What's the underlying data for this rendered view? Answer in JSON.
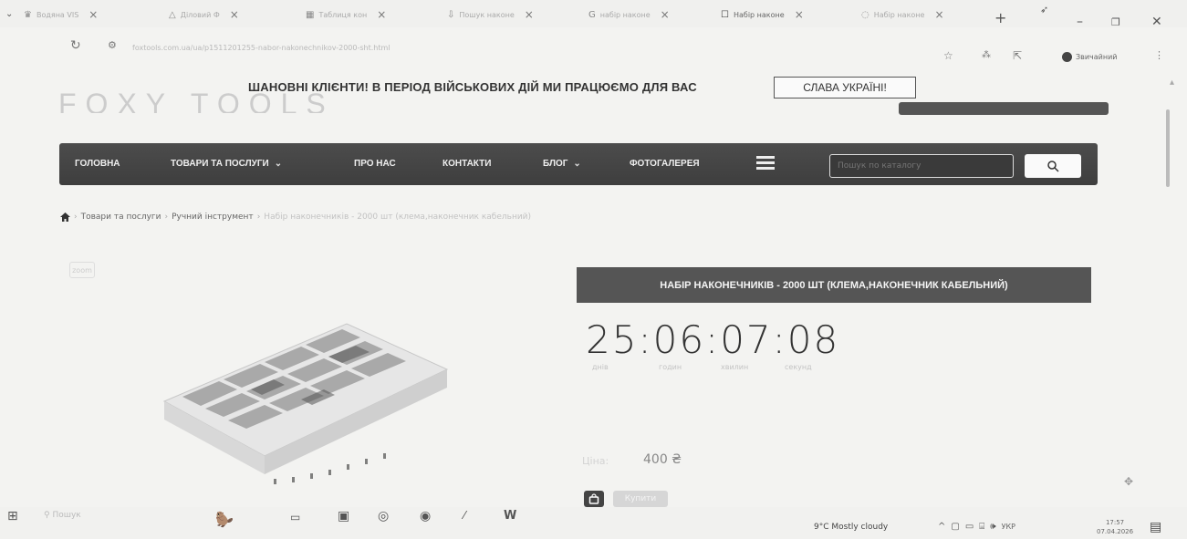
{
  "browser": {
    "tabs": [
      {
        "label": "Водяна VIS",
        "icon": "crown-icon",
        "close": "×"
      },
      {
        "label": "Діловий Ф",
        "icon": "drive-icon",
        "close": "×"
      },
      {
        "label": "Таблиця кон",
        "icon": "sheets-icon",
        "close": "×"
      },
      {
        "label": "Пошук наконе",
        "icon": "download-icon",
        "close": "×"
      },
      {
        "label": "набір наконе",
        "icon": "google-icon",
        "close": "×"
      },
      {
        "label": "Набір наконе",
        "icon": "page-icon",
        "close": "×"
      },
      {
        "label": "Набір наконе",
        "icon": "loading-icon",
        "close": "×"
      }
    ],
    "new_tab": "+",
    "url": "foxtools.com.ua/ua/p1511201255-nabor-nakonechnikov-2000-sht.html",
    "profile_label": "Звичайний"
  },
  "notice": {
    "text": "ШАНОВНІ КЛІЄНТИ! В ПЕРІОД ВІЙСЬКОВИХ ДІЙ МИ ПРАЦЮЄМО ДЛЯ ВАС",
    "button": "СЛАВА УКРАЇНІ!"
  },
  "logo": "FOXY TOOLS",
  "nav": {
    "items": [
      "ГОЛОВНА",
      "ТОВАРИ ТА ПОСЛУГИ",
      "ПРО НАС",
      "КОНТАКТИ",
      "БЛОГ",
      "ФОТОГАЛЕРЕЯ"
    ],
    "search_placeholder": "Пошук по каталогу"
  },
  "breadcrumb": {
    "items": [
      "Товари та послуги",
      "Ручний інструмент"
    ],
    "current": "Набір наконечників - 2000 шт (клема,наконечник кабельний)"
  },
  "product": {
    "title": "НАБІР НАКОНЕЧНИКІВ - 2000 ШТ (КЛЕМА,НАКОНЕЧНИК КАБЕЛЬНИЙ)",
    "countdown": "25:06:07:08",
    "countdown_labels": [
      "днів",
      "годин",
      "хвилин",
      "секунд"
    ],
    "price_label": "Ціна:",
    "price": "400 ₴",
    "buy_label": "Купити",
    "zoom_label": "zoom"
  },
  "taskbar": {
    "search": "Пошук",
    "weather": "9°C  Mostly cloudy",
    "lang": "УКР",
    "time": "17:57",
    "date": "07.04.2026"
  },
  "colors": {
    "nav_bg": "#444444",
    "title_bg": "#555555"
  }
}
